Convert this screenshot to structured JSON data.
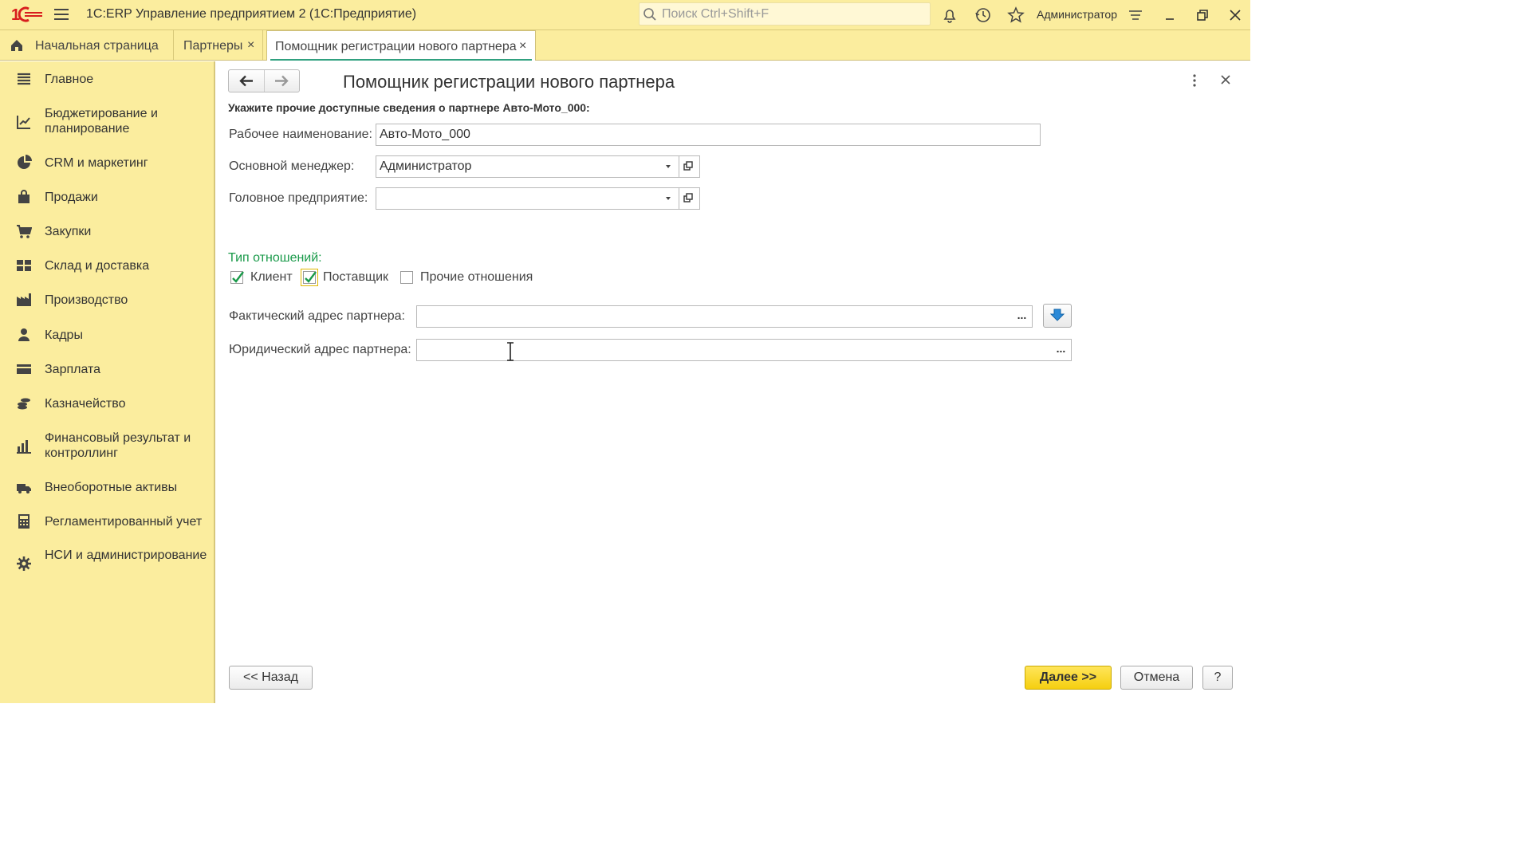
{
  "titlebar": {
    "app_title": "1С:ERP Управление предприятием 2  (1С:Предприятие)",
    "search_placeholder": "Поиск Ctrl+Shift+F",
    "user": "Администратор"
  },
  "tabs": [
    {
      "label": "Начальная страница"
    },
    {
      "label": "Партнеры",
      "close": "×"
    },
    {
      "label": "Помощник регистрации нового партнера",
      "close": "×"
    }
  ],
  "sidebar": {
    "items": [
      {
        "label": "Главное",
        "icon": "menu-list-icon"
      },
      {
        "label": "Бюджетирование и планирование",
        "icon": "budget-chart-icon"
      },
      {
        "label": "CRM и маркетинг",
        "icon": "pie-chart-icon"
      },
      {
        "label": "Продажи",
        "icon": "shopping-bag-icon"
      },
      {
        "label": "Закупки",
        "icon": "cart-icon"
      },
      {
        "label": "Склад и доставка",
        "icon": "warehouse-icon"
      },
      {
        "label": "Производство",
        "icon": "factory-icon"
      },
      {
        "label": "Кадры",
        "icon": "person-icon"
      },
      {
        "label": "Зарплата",
        "icon": "wallet-icon"
      },
      {
        "label": "Казначейство",
        "icon": "coins-icon"
      },
      {
        "label": "Финансовый результат и контроллинг",
        "icon": "bar-chart-icon"
      },
      {
        "label": "Внеоборотные активы",
        "icon": "truck-icon"
      },
      {
        "label": "Регламентированный учет",
        "icon": "calculator-icon"
      },
      {
        "label": "НСИ и администрирование",
        "icon": "gear-icon"
      }
    ]
  },
  "form": {
    "title": "Помощник регистрации нового партнера",
    "hint": "Укажите прочие доступные сведения о партнере Авто-Мото_000:",
    "working_name_label": "Рабочее наименование:",
    "working_name_value": "Авто-Мото_000",
    "manager_label": "Основной менеджер:",
    "manager_value": "Администратор",
    "parent_label": "Головное предприятие:",
    "parent_value": "",
    "relation_group_title": "Тип отношений:",
    "relations": [
      {
        "label": "Клиент",
        "checked": true
      },
      {
        "label": "Поставщик",
        "checked": true
      },
      {
        "label": "Прочие отношения",
        "checked": false
      }
    ],
    "actual_address_label": "Фактический адрес партнера:",
    "actual_address_value": "",
    "legal_address_label": "Юридический адрес партнера:",
    "legal_address_value": "",
    "ellipsis": "...",
    "back_button": "<< Назад",
    "next_button": "Далее >>",
    "cancel_button": "Отмена",
    "help_button": "?"
  },
  "colors": {
    "panel_yellow": "#fbed9e",
    "accent_green": "#1a9a4a",
    "primary_button": "#f5cf10",
    "logo_red": "#d81e1e"
  }
}
